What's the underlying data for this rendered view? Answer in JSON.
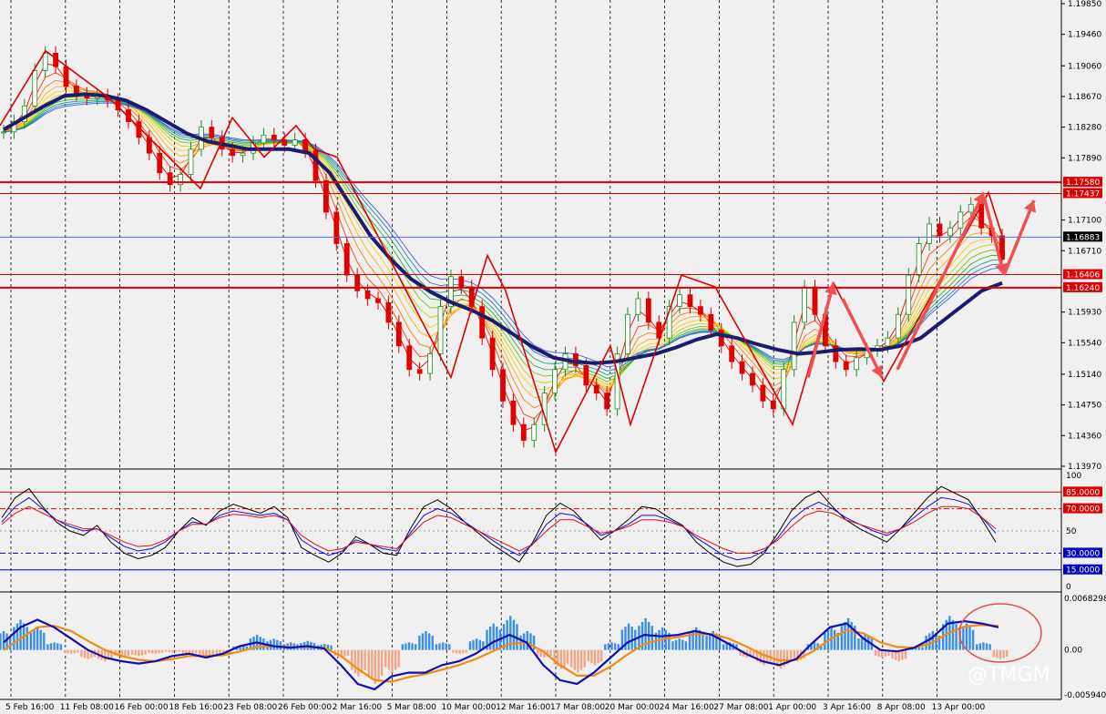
{
  "chart_data": {
    "type": "candlestick",
    "symbol_note": "",
    "x_dates": [
      "5 Feb 16:00",
      "11 Feb 08:00",
      "16 Feb 00:00",
      "18 Feb 16:00",
      "23 Feb 08:00",
      "26 Feb 00:00",
      "2 Mar 16:00",
      "5 Mar 08:00",
      "10 Mar 00:00",
      "12 Mar 16:00",
      "17 Mar 08:00",
      "20 Mar 00:00",
      "24 Mar 16:00",
      "27 Mar 08:00",
      "1 Apr 00:00",
      "3 Apr 16:00",
      "8 Apr 08:00",
      "13 Apr 00:00"
    ],
    "price_panel": {
      "ylim": [
        1.1397,
        1.1985
      ],
      "y_ticks": [
        "1.19850",
        "1.19460",
        "1.19060",
        "1.18670",
        "1.18280",
        "1.17890",
        "1.17100",
        "1.16710",
        "1.15930",
        "1.15540",
        "1.15140",
        "1.14750",
        "1.14360",
        "1.13970"
      ],
      "horizontal_levels": [
        {
          "label": "1.17580",
          "value": 1.1758,
          "color": "#e00000"
        },
        {
          "label": "1.17437",
          "value": 1.17437,
          "color": "#e00000"
        },
        {
          "label": "1.16883",
          "value": 1.16883,
          "color": "#4a6fd8"
        },
        {
          "label": "1.16406",
          "value": 1.16406,
          "color": "#e00000"
        },
        {
          "label": "1.16240",
          "value": 1.1624,
          "color": "#e00000"
        }
      ],
      "close_series": [
        1.1822,
        1.1835,
        1.1855,
        1.19,
        1.1922,
        1.1905,
        1.188,
        1.187,
        1.1865,
        1.1868,
        1.1862,
        1.185,
        1.1835,
        1.1815,
        1.1795,
        1.177,
        1.1755,
        1.1768,
        1.18,
        1.1828,
        1.1815,
        1.18,
        1.1792,
        1.1795,
        1.1808,
        1.1818,
        1.1812,
        1.1805,
        1.1812,
        1.1798,
        1.176,
        1.172,
        1.168,
        1.164,
        1.162,
        1.161,
        1.1605,
        1.158,
        1.155,
        1.152,
        1.1515,
        1.154,
        1.16,
        1.1638,
        1.1625,
        1.16,
        1.156,
        1.152,
        1.148,
        1.145,
        1.143,
        1.145,
        1.149,
        1.152,
        1.154,
        1.1525,
        1.15,
        1.149,
        1.147,
        1.154,
        1.159,
        1.161,
        1.158,
        1.156,
        1.16,
        1.1615,
        1.16,
        1.159,
        1.157,
        1.155,
        1.153,
        1.1515,
        1.15,
        1.148,
        1.147,
        1.152,
        1.158,
        1.1625,
        1.159,
        1.155,
        1.153,
        1.152,
        1.1535,
        1.1545,
        1.155,
        1.156,
        1.159,
        1.164,
        1.168,
        1.1705,
        1.169,
        1.17,
        1.172,
        1.173,
        1.17,
        1.169,
        1.166
      ],
      "slow_ma_series": [
        1.1825,
        1.184,
        1.1855,
        1.1868,
        1.187,
        1.1868,
        1.1862,
        1.185,
        1.1835,
        1.182,
        1.181,
        1.1805,
        1.18,
        1.18,
        1.18,
        1.1795,
        1.177,
        1.173,
        1.169,
        1.166,
        1.1635,
        1.1618,
        1.1605,
        1.1595,
        1.1582,
        1.1565,
        1.1548,
        1.1535,
        1.153,
        1.1528,
        1.153,
        1.1535,
        1.154,
        1.1548,
        1.1558,
        1.1565,
        1.156,
        1.1552,
        1.1545,
        1.154,
        1.1542,
        1.1545,
        1.1546,
        1.1545,
        1.155,
        1.156,
        1.158,
        1.16,
        1.162,
        1.163
      ]
    },
    "stochastic_panel": {
      "ylim": [
        0,
        100
      ],
      "y_ticks": [
        "100",
        "50",
        "0"
      ],
      "levels": [
        {
          "label": "85.0000",
          "value": 85,
          "color": "#e00000"
        },
        {
          "label": "70.0000",
          "value": 70,
          "color": "#e00000"
        },
        {
          "label": "30.0000",
          "value": 30,
          "color": "#0000c0"
        },
        {
          "label": "15.0000",
          "value": 15,
          "color": "#0000c0"
        }
      ],
      "series": [
        {
          "color": "#000000",
          "values": [
            62,
            80,
            88,
            72,
            58,
            50,
            46,
            55,
            40,
            30,
            25,
            28,
            35,
            50,
            62,
            55,
            68,
            74,
            70,
            66,
            72,
            62,
            35,
            28,
            22,
            30,
            45,
            38,
            30,
            28,
            52,
            72,
            78,
            70,
            58,
            48,
            38,
            30,
            22,
            40,
            64,
            75,
            68,
            55,
            42,
            50,
            60,
            72,
            70,
            62,
            55,
            40,
            30,
            22,
            18,
            20,
            30,
            48,
            68,
            80,
            86,
            72,
            60,
            52,
            46,
            40,
            52,
            66,
            80,
            90,
            84,
            78,
            60,
            40
          ]
        },
        {
          "color": "#1010d0",
          "values": [
            58,
            72,
            80,
            70,
            60,
            54,
            50,
            52,
            44,
            36,
            32,
            34,
            40,
            50,
            58,
            56,
            64,
            68,
            66,
            64,
            66,
            60,
            42,
            34,
            28,
            32,
            42,
            38,
            34,
            32,
            48,
            64,
            70,
            66,
            58,
            50,
            42,
            34,
            28,
            38,
            56,
            66,
            64,
            56,
            46,
            50,
            56,
            64,
            64,
            60,
            54,
            44,
            36,
            28,
            24,
            26,
            32,
            44,
            60,
            70,
            76,
            70,
            62,
            56,
            50,
            46,
            52,
            62,
            72,
            80,
            78,
            74,
            62,
            48
          ]
        },
        {
          "color": "#e01010",
          "values": [
            56,
            66,
            72,
            66,
            60,
            56,
            52,
            52,
            46,
            40,
            36,
            37,
            42,
            50,
            56,
            56,
            62,
            65,
            64,
            62,
            64,
            60,
            46,
            38,
            32,
            34,
            40,
            38,
            36,
            34,
            46,
            58,
            64,
            62,
            56,
            50,
            44,
            38,
            32,
            38,
            50,
            60,
            60,
            54,
            48,
            50,
            54,
            60,
            60,
            58,
            54,
            46,
            40,
            34,
            30,
            30,
            34,
            42,
            54,
            64,
            68,
            66,
            60,
            56,
            52,
            48,
            52,
            58,
            66,
            72,
            72,
            70,
            62,
            52
          ]
        }
      ]
    },
    "macd_panel": {
      "ylim": [
        -0.0059409,
        0.0068298
      ],
      "y_ticks": [
        "0.0068298",
        "0.00",
        "-0.0059409"
      ],
      "histogram": [
        0.0025,
        0.004,
        0.003,
        0.001,
        -0.0005,
        -0.0012,
        -0.0015,
        -0.001,
        -0.0008,
        -0.0005,
        -0.0003,
        -0.0006,
        -0.001,
        -0.0008,
        0.0006,
        0.002,
        0.0015,
        0.001,
        0.0012,
        0.0008,
        -0.001,
        -0.0035,
        -0.0045,
        -0.003,
        0.001,
        0.0025,
        0.001,
        -0.0005,
        0.0015,
        0.0035,
        0.0045,
        0.0025,
        -0.001,
        -0.0025,
        -0.003,
        -0.002,
        0.001,
        0.0035,
        0.0042,
        0.003,
        0.0015,
        0.003,
        0.0025,
        0.001,
        -0.001,
        -0.002,
        -0.0025,
        -0.0015,
        0.001,
        0.003,
        0.0042,
        0.002,
        -0.001,
        -0.0015,
        0.0005,
        0.0025,
        0.0045,
        0.0035,
        0.001,
        -0.0012
      ],
      "macd_line": [
        0.001,
        0.003,
        0.004,
        0.003,
        0.0015,
        0.0,
        -0.001,
        -0.0015,
        -0.0018,
        -0.0015,
        -0.0008,
        -0.0005,
        -0.001,
        -0.0005,
        0.0005,
        0.001,
        0.0005,
        0.0003,
        0.0005,
        0.0002,
        -0.002,
        -0.0045,
        -0.0052,
        -0.0035,
        -0.003,
        -0.003,
        -0.002,
        -0.0015,
        -0.0005,
        0.001,
        0.002,
        0.001,
        -0.002,
        -0.004,
        -0.0045,
        -0.003,
        -0.001,
        0.001,
        0.002,
        0.0018,
        0.002,
        0.0025,
        0.002,
        0.0008,
        -0.0005,
        -0.0015,
        -0.002,
        -0.0012,
        0.001,
        0.003,
        0.0035,
        0.0015,
        0.0,
        -0.0002,
        0.0003,
        0.0015,
        0.0035,
        0.0038,
        0.0035,
        0.003
      ],
      "signal_line": [
        0.0,
        0.0015,
        0.003,
        0.0032,
        0.0025,
        0.0012,
        0.0,
        -0.0008,
        -0.0013,
        -0.0015,
        -0.0012,
        -0.0008,
        -0.0008,
        -0.0007,
        -0.0002,
        0.0004,
        0.0005,
        0.0004,
        0.0004,
        0.0003,
        -0.0008,
        -0.0025,
        -0.004,
        -0.0042,
        -0.0036,
        -0.0032,
        -0.0026,
        -0.002,
        -0.0012,
        -0.0002,
        0.0008,
        0.001,
        -0.0002,
        -0.002,
        -0.0034,
        -0.0034,
        -0.0022,
        -0.0006,
        0.0008,
        0.0014,
        0.0017,
        0.0021,
        0.0021,
        0.0015,
        0.0005,
        -0.0006,
        -0.0014,
        -0.0013,
        -0.0002,
        0.0014,
        0.0026,
        0.0022,
        0.001,
        0.0004,
        0.0003,
        0.0009,
        0.0022,
        0.0031,
        0.0033,
        0.0032
      ]
    }
  },
  "watermark": "@TMGM",
  "colors": {
    "background": "#f0f0f0",
    "grid": "#000000",
    "bull_candle": "#1a8f1a",
    "bear_candle": "#e00000",
    "slow_ma": "#1c1c6e",
    "zigzag": "#e00000",
    "forecast_arrow": "#f05050",
    "hist_pos": "#3a8ee8",
    "hist_neg": "#f4a488",
    "macd_line": "#1010b0",
    "signal_line": "#f08c10",
    "highlight_circle": "#e05050"
  }
}
